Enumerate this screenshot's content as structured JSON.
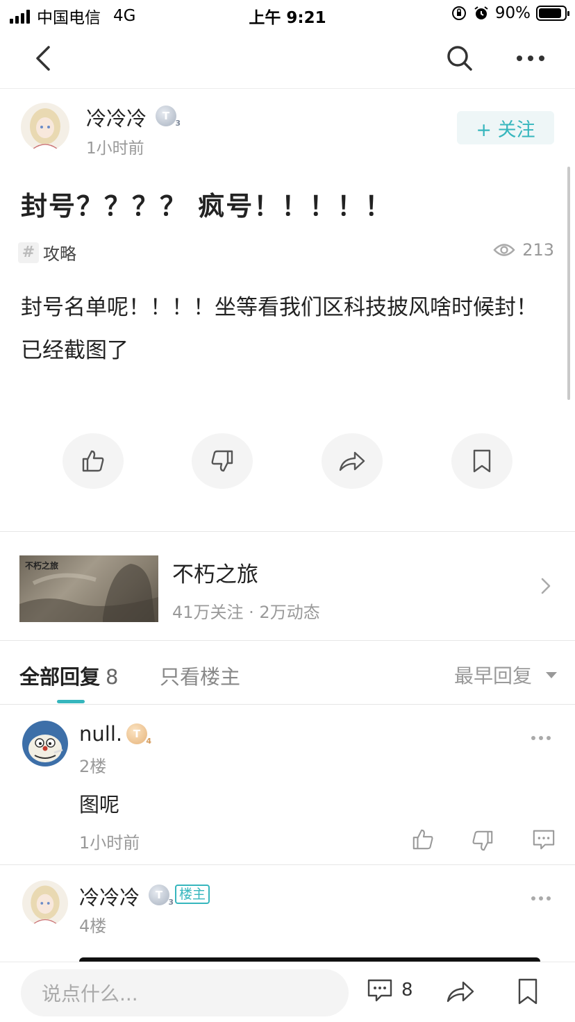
{
  "status_bar": {
    "carrier": "中国电信",
    "network": "4G",
    "time": "上午 9:21",
    "battery": "90%",
    "battery_level": 0.9
  },
  "post": {
    "author": {
      "name": "冷冷冷",
      "level": "T",
      "level_sub": "3",
      "time": "1小时前"
    },
    "follow_label": "+ 关注",
    "title": "封号？？？？ 疯号！！！！！",
    "tag": "攻略",
    "tag_icon": "#",
    "views": "213",
    "body": "封号名单呢！！！！坐等看我们区科技披风啥时候封！已经截图了"
  },
  "forum": {
    "name": "不朽之旅",
    "thumb_label": "不朽之旅",
    "stats": "41万关注 · 2万动态"
  },
  "replies_header": {
    "all_label": "全部回复",
    "count": "8",
    "owner_only": "只看楼主",
    "sort": "最早回复"
  },
  "replies": [
    {
      "name": "null.",
      "level": "T",
      "level_sub": "4",
      "floor": "2楼",
      "text": "图呢",
      "time": "1小时前"
    },
    {
      "name": "冷冷冷",
      "level": "T",
      "level_sub": "3",
      "badge": "楼主",
      "floor": "4楼"
    }
  ],
  "bottom_bar": {
    "placeholder": "说点什么...",
    "comment_count": "8"
  },
  "colors": {
    "accent": "#36b6bd",
    "muted": "#999999"
  }
}
